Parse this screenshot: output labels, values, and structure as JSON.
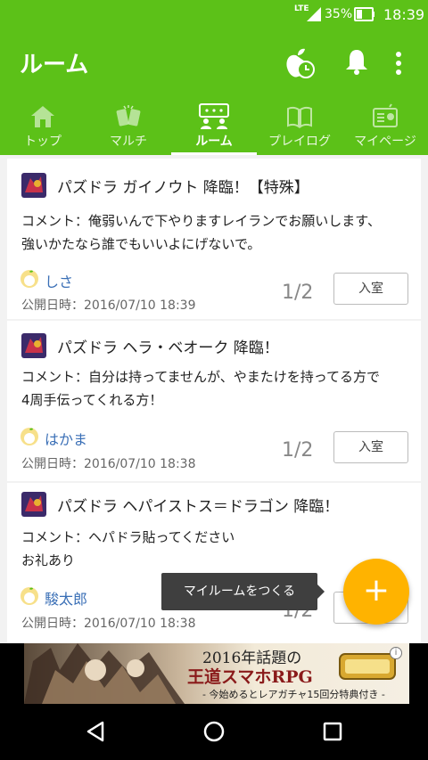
{
  "status_bar": {
    "network": "LTE",
    "battery": "35%",
    "time": "18:39"
  },
  "app_bar": {
    "title": "ルーム"
  },
  "tabs": [
    {
      "label": "トップ"
    },
    {
      "label": "マルチ"
    },
    {
      "label": "ルーム"
    },
    {
      "label": "プレイログ"
    },
    {
      "label": "マイページ"
    }
  ],
  "rooms": [
    {
      "title": "パズドラ ガイノウト 降臨！【特殊】",
      "comment_line1": "コメント：俺弱いんで下やりますレイランでお願いします、",
      "comment_line2": "強いかたなら誰でもいいよにげないで。",
      "user": "しさ",
      "date": "公開日時：2016/07/10 18:39",
      "count": "1/2",
      "button": "入室"
    },
    {
      "title": "パズドラ ヘラ・ベオーク 降臨！",
      "comment_line1": "コメント：自分は持ってませんが、やまたけを持ってる方で",
      "comment_line2": "4周手伝ってくれる方！",
      "user": "はかま",
      "date": "公開日時：2016/07/10 18:38",
      "count": "1/2",
      "button": "入室"
    },
    {
      "title": "パズドラ ヘパイストス＝ドラゴン 降臨！",
      "comment_line1": "コメント：ヘパドラ貼ってください",
      "comment_line2": "お礼あり",
      "user": "駿太郎",
      "date": "公開日時：2016/07/10 18:38",
      "count": "1/2",
      "button": ""
    }
  ],
  "fab": {
    "tooltip": "マイルームをつくる",
    "symbol": "+"
  },
  "ad": {
    "title": "2016年話題の",
    "subtitle": "王道スマホRPG",
    "footer": "- 今始めるとレアガチャ15回分特典付き -",
    "info": "i"
  },
  "colors": {
    "primary": "#5cc118",
    "fab": "#ffb300",
    "link": "#3a6fb6"
  }
}
